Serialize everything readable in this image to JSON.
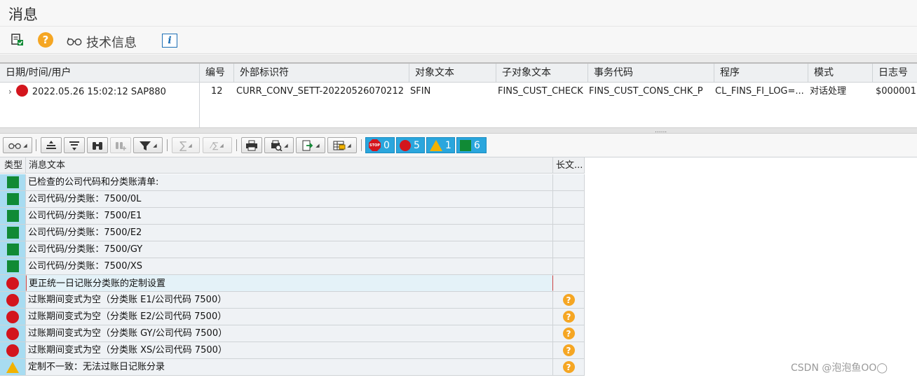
{
  "window": {
    "title": "消息"
  },
  "toolbar": {
    "tech_info_label": "技术信息",
    "help_glyph": "?",
    "info_glyph": "i",
    "icons": [
      "document-check-icon",
      "help-icon",
      "glasses-icon",
      "info-icon"
    ]
  },
  "header_table": {
    "columns": [
      "日期/时间/用户",
      "编号",
      "外部标识符",
      "对象文本",
      "子对象文本",
      "事务代码",
      "程序",
      "模式",
      "日志号"
    ],
    "row": {
      "datetime_user": "2022.05.26  15:02:12  SAP880",
      "number": "12",
      "external_id": "CURR_CONV_SETT-20220526070212",
      "object_text": "SFIN",
      "subobject_text": "FINS_CUST_CHECK",
      "tcode": "FINS_CUST_CONS_CHK_P",
      "program": "CL_FINS_FI_LOG=...",
      "mode": "对话处理",
      "log_number": "$000001"
    }
  },
  "splitter": {
    "grip": "......"
  },
  "alv_toolbar": {
    "sum_glyph": "∑",
    "subtotal_glyph": "⁄∑",
    "counts": {
      "stop": "0",
      "error": "5",
      "warning": "1",
      "success": "6"
    },
    "stop_label": "STOP"
  },
  "message_table": {
    "columns": {
      "type": "类型",
      "message": "消息文本",
      "long_text": "长文..."
    },
    "rows": [
      {
        "type": "success",
        "text": "已检查的公司代码和分类账清单:",
        "long_text": false
      },
      {
        "type": "success",
        "text": "公司代码/分类账：7500/0L",
        "long_text": false
      },
      {
        "type": "success",
        "text": "公司代码/分类账：7500/E1",
        "long_text": false
      },
      {
        "type": "success",
        "text": "公司代码/分类账：7500/E2",
        "long_text": false
      },
      {
        "type": "success",
        "text": "公司代码/分类账：7500/GY",
        "long_text": false
      },
      {
        "type": "success",
        "text": "公司代码/分类账：7500/XS",
        "long_text": false
      },
      {
        "type": "error",
        "text": "更正统一日记账分类账的定制设置",
        "long_text": false
      },
      {
        "type": "error",
        "text": "过账期间变式为空（分类账 E1/公司代码 7500）",
        "long_text": true
      },
      {
        "type": "error",
        "text": "过账期间变式为空（分类账 E2/公司代码 7500）",
        "long_text": true
      },
      {
        "type": "error",
        "text": "过账期间变式为空（分类账 GY/公司代码 7500）",
        "long_text": true
      },
      {
        "type": "error",
        "text": "过账期间变式为空（分类账 XS/公司代码 7500）",
        "long_text": true
      },
      {
        "type": "warning",
        "text": "定制不一致：无法过账日记账分录",
        "long_text": true
      }
    ],
    "selected_row_index": 6
  },
  "watermark": "CSDN @泡泡鱼OO◯"
}
